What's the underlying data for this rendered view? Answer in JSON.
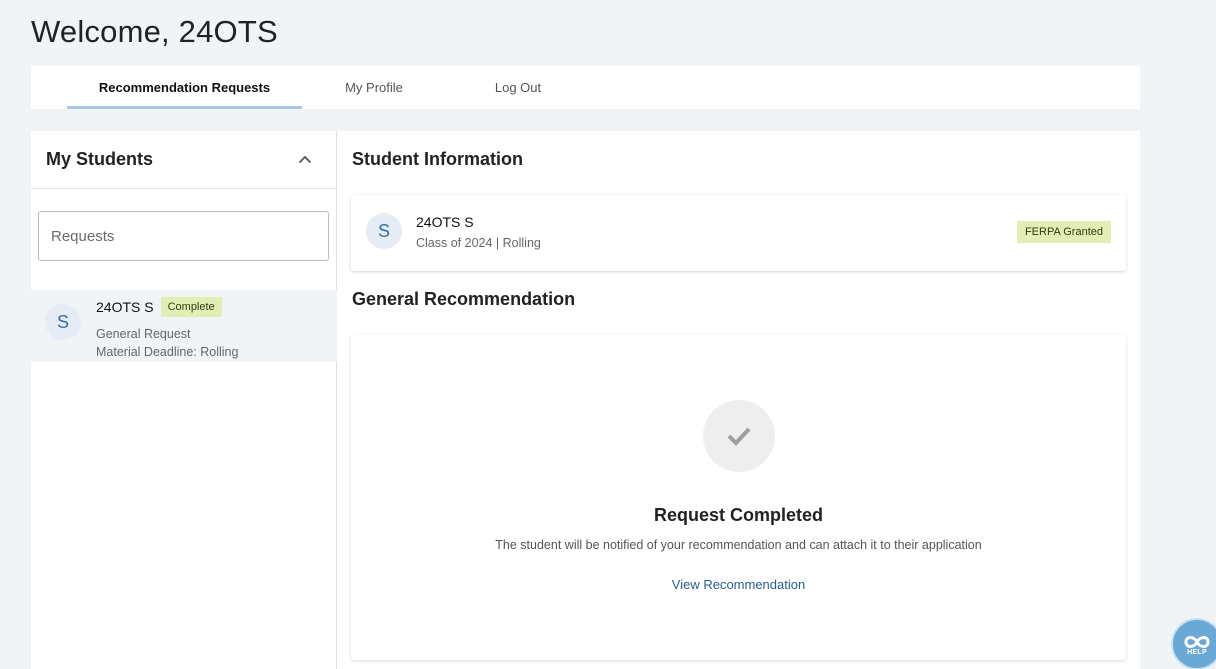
{
  "header": {
    "title": "Welcome, 24OTS"
  },
  "tabs": [
    {
      "label": "Recommendation Requests",
      "active": true
    },
    {
      "label": "My Profile",
      "active": false
    },
    {
      "label": "Log Out",
      "active": false
    }
  ],
  "sidebar": {
    "title": "My Students",
    "search_placeholder": "Requests",
    "students": [
      {
        "initial": "S",
        "name": "24OTS S",
        "status": "Complete",
        "request_type": "General Request",
        "deadline": "Material Deadline: Rolling"
      }
    ]
  },
  "student_info": {
    "section_title": "Student Information",
    "initial": "S",
    "name": "24OTS S",
    "detail": "Class of 2024 | Rolling",
    "ferpa_badge": "FERPA Granted"
  },
  "recommendation": {
    "section_title": "General Recommendation",
    "status_title": "Request Completed",
    "description": "The student will be notified of your recommendation and can attach it to their application",
    "link_label": "View Recommendation"
  },
  "help": {
    "label": "HELP"
  },
  "colors": {
    "background": "#f1f4f7",
    "accent": "#a9c8e8",
    "badge": "#e2efb4",
    "link": "#2a5d93",
    "avatar_bg": "#e5ecf5"
  }
}
